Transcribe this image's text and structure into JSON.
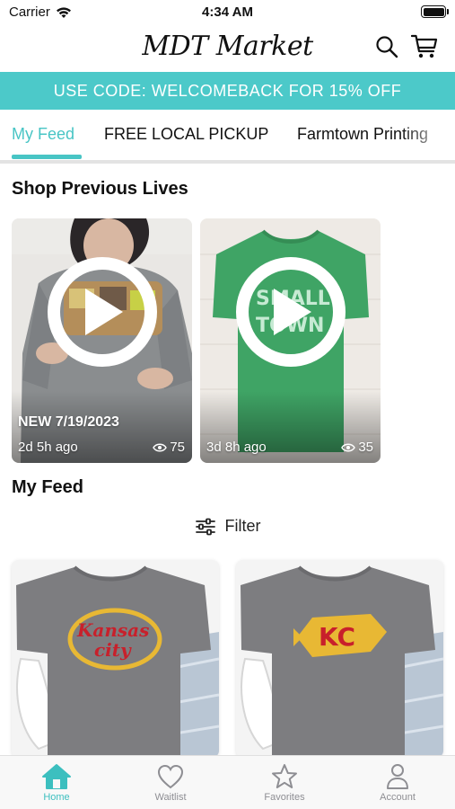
{
  "status_bar": {
    "carrier": "Carrier",
    "time": "4:34 AM"
  },
  "header": {
    "logo": "MDT Market"
  },
  "promo": {
    "text": "USE CODE: WELCOMEBACK FOR 15% OFF"
  },
  "tabs": [
    {
      "label": "My Feed",
      "active": true
    },
    {
      "label": "FREE LOCAL PICKUP",
      "active": false
    },
    {
      "label": "Farmtown Printing",
      "active": false
    }
  ],
  "previous_lives": {
    "title": "Shop Previous Lives",
    "items": [
      {
        "tag": "NEW 7/19/2023",
        "ago": "2d 5h ago",
        "views": "75"
      },
      {
        "tag": "",
        "ago": "3d 8h ago",
        "views": "35"
      }
    ]
  },
  "feed": {
    "title": "My Feed",
    "filter_label": "Filter",
    "products": [
      {
        "design": "Kansas City"
      },
      {
        "design": "KC"
      }
    ]
  },
  "bottom_nav": [
    {
      "label": "Home",
      "icon": "home-icon",
      "active": true
    },
    {
      "label": "Waitlist",
      "icon": "heart-icon",
      "active": false
    },
    {
      "label": "Favorites",
      "icon": "star-icon",
      "active": false
    },
    {
      "label": "Account",
      "icon": "person-icon",
      "active": false
    }
  ],
  "colors": {
    "accent": "#4cc9c9",
    "tab_active": "#48c5c5",
    "shirt_gray": "#7d7d80",
    "shirt_green": "#3fa465"
  }
}
